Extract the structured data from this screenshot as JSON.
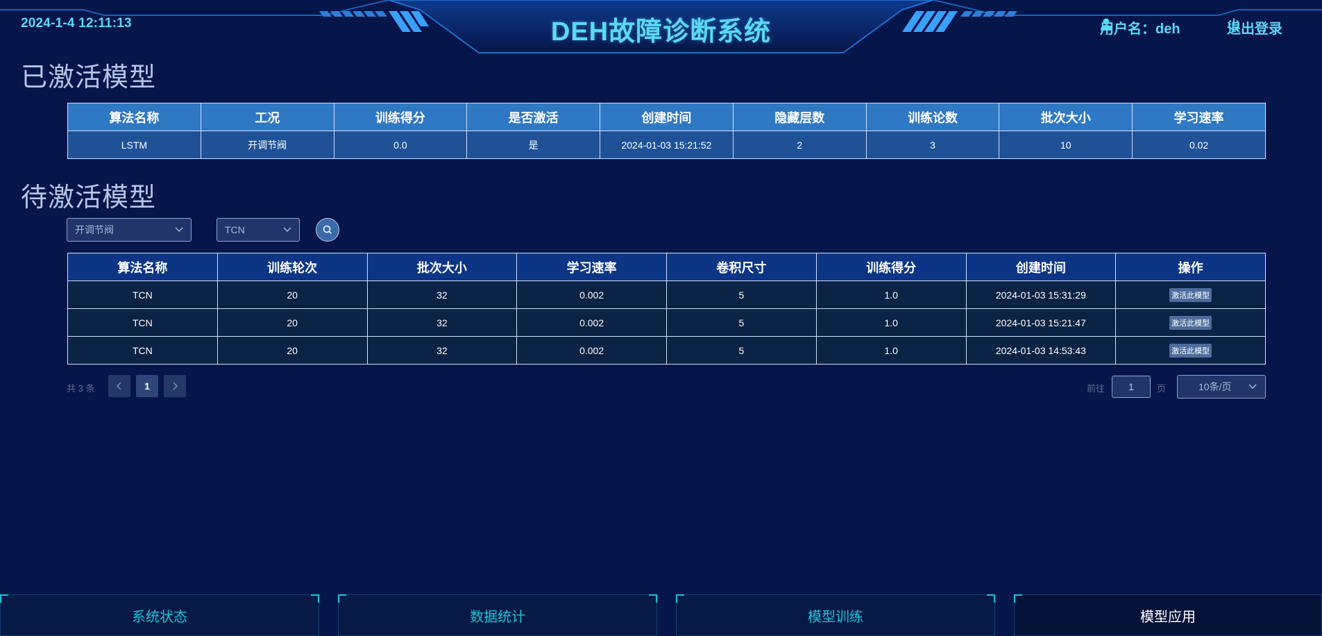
{
  "header": {
    "datetime": "2024-1-4 12:11:13",
    "title": "DEH故障诊断系统",
    "user_label": "用户名：deh",
    "logout_label": "退出登录",
    "accent_color": "#5ad8f5"
  },
  "active_section": {
    "title": "已激活模型",
    "columns": [
      "算法名称",
      "工况",
      "训练得分",
      "是否激活",
      "创建时间",
      "隐藏层数",
      "训练论数",
      "批次大小",
      "学习速率"
    ],
    "rows": [
      [
        "LSTM",
        "开调节阀",
        "0.0",
        "是",
        "2024-01-03 15:21:52",
        "2",
        "3",
        "10",
        "0.02"
      ]
    ]
  },
  "pending_section": {
    "title": "待激活模型",
    "condition_select": "开调节阀",
    "algorithm_select": "TCN",
    "columns": [
      "算法名称",
      "训练轮次",
      "批次大小",
      "学习速率",
      "卷积尺寸",
      "训练得分",
      "创建时间",
      "操作"
    ],
    "action_label": "激活此模型",
    "rows": [
      [
        "TCN",
        "20",
        "32",
        "0.002",
        "5",
        "1.0",
        "2024-01-03 15:31:29"
      ],
      [
        "TCN",
        "20",
        "32",
        "0.002",
        "5",
        "1.0",
        "2024-01-03 15:21:47"
      ],
      [
        "TCN",
        "20",
        "32",
        "0.002",
        "5",
        "1.0",
        "2024-01-03 14:53:43"
      ]
    ]
  },
  "pagination": {
    "total_text": "共 3 条",
    "current_page": "1",
    "goto_label": "前往",
    "goto_value": "1",
    "page_unit": "页",
    "page_size": "10条/页"
  },
  "nav": {
    "tabs": [
      "系统状态",
      "数据统计",
      "模型训练",
      "模型应用"
    ],
    "active_tab": "模型应用"
  },
  "icons": {
    "user": "user-icon",
    "logout": "power-icon",
    "search": "search-icon",
    "dropdown": "chevron-down-icon",
    "prev": "chevron-left-icon",
    "next": "chevron-right-icon"
  }
}
